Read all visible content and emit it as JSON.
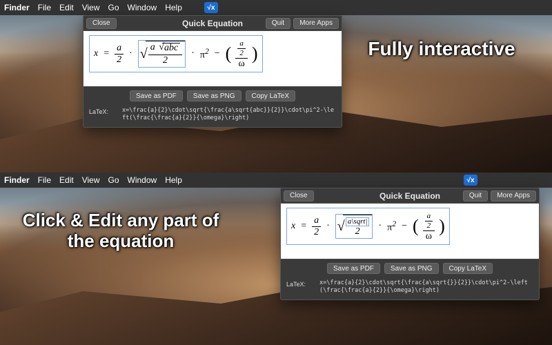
{
  "menubar": {
    "app": "Finder",
    "items": [
      "File",
      "Edit",
      "View",
      "Go",
      "Window",
      "Help"
    ],
    "app_icon_glyph": "√x"
  },
  "panel": {
    "title": "Quick Equation",
    "close_label": "Close",
    "quit_label": "Quit",
    "more_apps_label": "More Apps",
    "save_pdf_label": "Save as PDF",
    "save_png_label": "Save as PNG",
    "copy_latex_label": "Copy LaTeX",
    "latex_label": "LaTeX:"
  },
  "top": {
    "tagline": "Fully interactive",
    "equation": {
      "display": "x = (a/2) · √( (a·√(abc)) / 2 ) · π² − ( (a/2) / ω )",
      "latex_source": "x=\\frac{a}{2}\\cdot\\sqrt{\\frac{a\\sqrt{abc}}{2}}\\cdot\\pi^2-\\left(\\frac{\\frac{a}{2}}{\\omega}\\right)",
      "lhs": "x",
      "frac1": {
        "num": "a",
        "den": "2"
      },
      "sqrt": {
        "frac": {
          "num_a": "a",
          "num_radicand": "abc",
          "den": "2"
        }
      },
      "pi_term": "π",
      "pi_exp": "2",
      "paren_frac": {
        "outer_num": {
          "num": "a",
          "den": "2"
        },
        "outer_den": "ω"
      }
    }
  },
  "bottom": {
    "tagline": "Click & Edit any part of the equation",
    "equation": {
      "display": "x = (a/2) · √( a\\sqrt| / 2 ) · π² − ( (a/2) / ω )",
      "edit_token": "a\\sqrt|",
      "latex_source": "x=\\frac{a}{2}\\cdot\\sqrt{\\frac{a\\sqrt{}}{2}}\\cdot\\pi^2-\\left(\\frac{\\frac{a}{2}}{\\omega}\\right)",
      "lhs": "x",
      "frac1": {
        "num": "a",
        "den": "2"
      },
      "sqrt": {
        "frac": {
          "den": "2"
        }
      },
      "pi_term": "π",
      "pi_exp": "2",
      "paren_frac": {
        "outer_num": {
          "num": "a",
          "den": "2"
        },
        "outer_den": "ω"
      }
    }
  }
}
